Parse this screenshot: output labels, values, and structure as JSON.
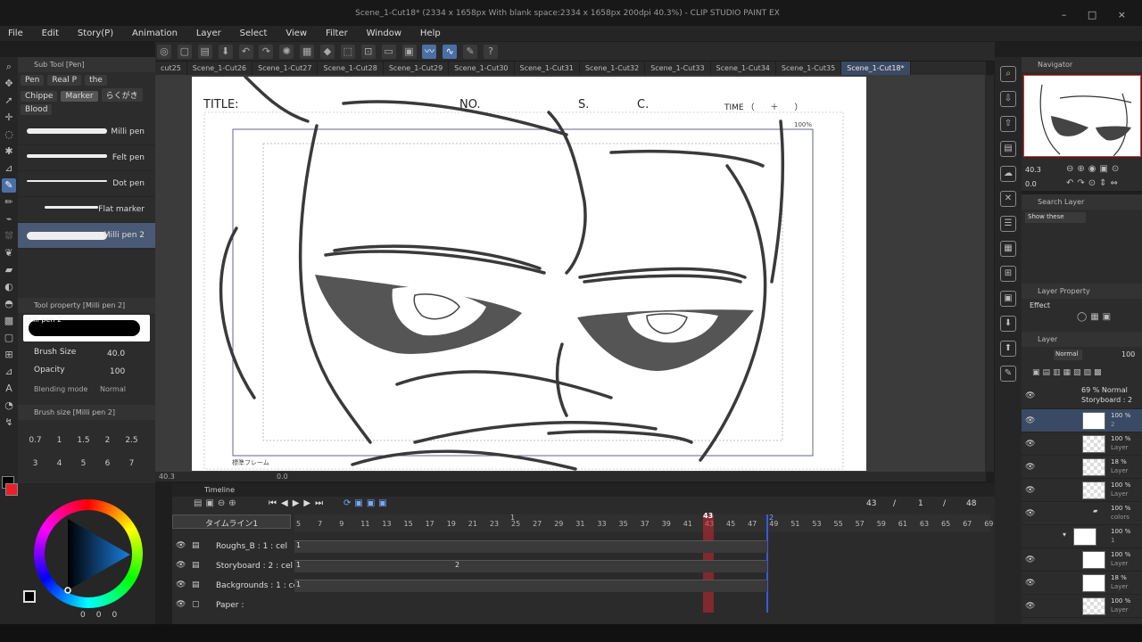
{
  "window": {
    "title": "Scene_1-Cut18* (2334 x 1658px With blank space:2334 x 1658px 200dpi 40.3%) - CLIP STUDIO PAINT EX",
    "controls": [
      "–",
      "□",
      "×"
    ]
  },
  "menu": [
    "File",
    "Edit",
    "Story(P)",
    "Animation",
    "Layer",
    "Select",
    "View",
    "Filter",
    "Window",
    "Help"
  ],
  "doc_tabs": [
    {
      "label": "cut25",
      "active": false
    },
    {
      "label": "Scene_1-Cut26",
      "active": false
    },
    {
      "label": "Scene_1-Cut27",
      "active": false
    },
    {
      "label": "Scene_1-Cut28",
      "active": false
    },
    {
      "label": "Scene_1-Cut29",
      "active": false
    },
    {
      "label": "Scene_1-Cut30",
      "active": false
    },
    {
      "label": "Scene_1-Cut31",
      "active": false
    },
    {
      "label": "Scene_1-Cut32",
      "active": false
    },
    {
      "label": "Scene_1-Cut33",
      "active": false
    },
    {
      "label": "Scene_1-Cut34",
      "active": false
    },
    {
      "label": "Scene_1-Cut35",
      "active": false
    },
    {
      "label": "Scene_1-Cut18*",
      "active": true
    }
  ],
  "subtool": {
    "header": "Sub Tool [Pen]",
    "tabs_row1": [
      "Pen",
      "Real P",
      "the"
    ],
    "tabs_row2": [
      "Chippe",
      "Marker",
      "らくがき"
    ],
    "tabs_row3": [
      "Blood"
    ],
    "brushes": [
      {
        "label": "Milli pen",
        "selected": false
      },
      {
        "label": "Felt pen",
        "selected": false
      },
      {
        "label": "Dot pen",
        "selected": false
      },
      {
        "label": "Flat marker",
        "selected": false
      },
      {
        "label": "Milli pen 2",
        "selected": true
      }
    ]
  },
  "tool_property": {
    "header": "Tool property [Milli pen 2]",
    "preview_label": "Milli pen 2",
    "brush_size_label": "Brush Size",
    "brush_size_value": "40.0",
    "opacity_label": "Opacity",
    "opacity_value": "100",
    "blending_label": "Blending mode",
    "blending_value": "Normal"
  },
  "brush_size_panel": {
    "header": "Brush size [Milli pen 2]",
    "row1": [
      "0.7",
      "1",
      "1.5",
      "2",
      "2.5"
    ],
    "row2": [
      "3",
      "4",
      "5",
      "6",
      "7"
    ]
  },
  "color": {
    "main": "#000000",
    "sub": "#e8202a",
    "values": [
      "0",
      "0",
      "0"
    ]
  },
  "storyboard": {
    "title": "TITLE:",
    "no": "NO.",
    "s": "S.",
    "c": "C.",
    "time": "TIME （　　＋　　）",
    "zoom_label": "100%",
    "frame_label": "標準フレーム"
  },
  "status": {
    "zoom": "40.3",
    "angle": "0.0"
  },
  "navigator": {
    "header": "Navigator",
    "zoom": "40.3",
    "rotate": "0.0"
  },
  "search_layer": {
    "header": "Search Layer",
    "filter": "Show these"
  },
  "layer_property": {
    "header": "Layer Property",
    "effect": "Effect"
  },
  "layer_panel": {
    "header": "Layer",
    "blend": "Normal",
    "opacity": "100",
    "folder_name": "69 % Normal",
    "folder_sub": "Storyboard : 2",
    "rows": [
      {
        "pct": "100 %",
        "name": "2",
        "checker": false,
        "sel": true
      },
      {
        "pct": "100 %",
        "name": "Layer",
        "checker": true,
        "sel": false
      },
      {
        "pct": "18 %",
        "name": "Layer",
        "checker": true,
        "sel": false
      },
      {
        "pct": "100 %",
        "name": "Layer",
        "checker": true,
        "sel": false
      },
      {
        "pct": "100 %",
        "name": "colors",
        "checker": false,
        "sel": false
      },
      {
        "pct": "100 %",
        "name": "1",
        "checker": false,
        "sel": false
      },
      {
        "pct": "100 %",
        "name": "Layer",
        "checker": false,
        "sel": false
      },
      {
        "pct": "18 %",
        "name": "Layer",
        "checker": false,
        "sel": false
      },
      {
        "pct": "100 %",
        "name": "Layer",
        "checker": true,
        "sel": false
      }
    ]
  },
  "timeline": {
    "header": "Timeline",
    "name": "タイムライン1",
    "current_frame": "43",
    "slash1": "/",
    "total_a": "1",
    "slash2": "/",
    "total_b": "48",
    "frames": [
      "5",
      "7",
      "9",
      "11",
      "13",
      "15",
      "17",
      "19",
      "21",
      "23",
      "25",
      "27",
      "29",
      "31",
      "33",
      "35",
      "37",
      "39",
      "41",
      "43",
      "45",
      "47",
      "49",
      "51",
      "53",
      "55",
      "57",
      "59",
      "61",
      "63",
      "65",
      "67",
      "69"
    ],
    "marker_1": "1",
    "playhead_label": "43",
    "end_marker": "2",
    "tracks": [
      {
        "name": "Roughs_B : 1 : cel",
        "cels": [
          "1"
        ]
      },
      {
        "name": "Storyboard : 2 : cel",
        "cels": [
          "1",
          "2"
        ]
      },
      {
        "name": "Backgrounds : 1 : cel",
        "cels": [
          "1"
        ]
      },
      {
        "name": "Paper :",
        "cels": []
      }
    ]
  }
}
